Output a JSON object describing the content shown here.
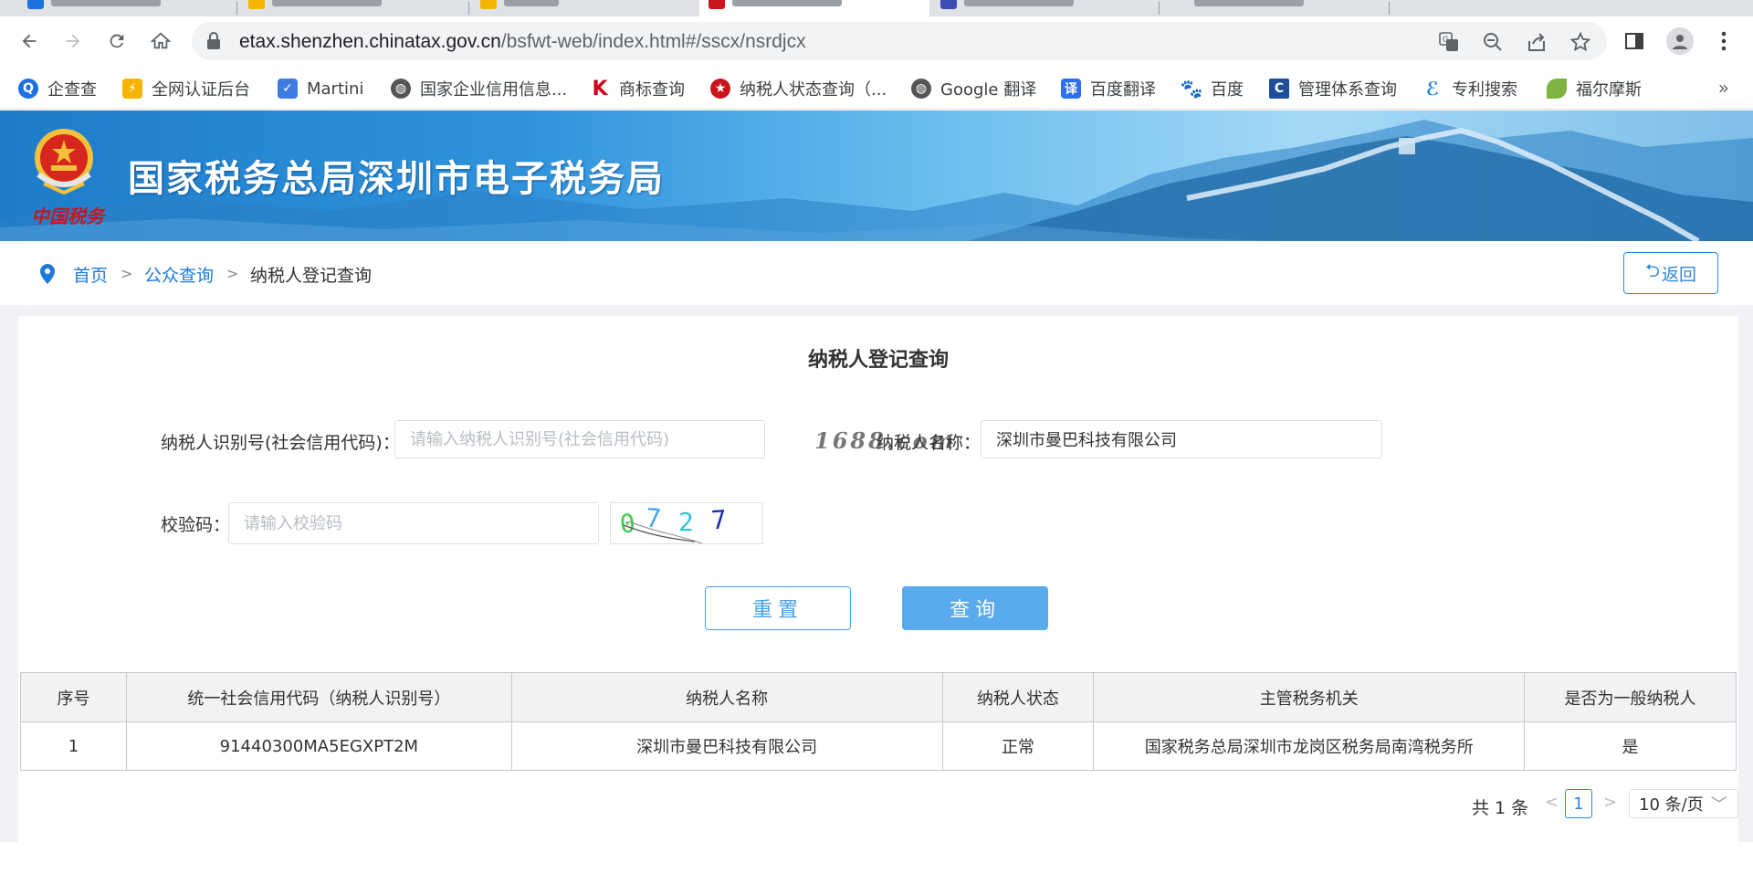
{
  "browser": {
    "url_host": "etax.shenzhen.chinatax.gov.cn",
    "url_path": "/bsfwt-web/index.html#/sscx/nsrdjcx",
    "bookmarks": [
      {
        "label": "企查查",
        "icon": "qichacha-icon",
        "color": "#1e6fe0"
      },
      {
        "label": "全网认证后台",
        "icon": "cert-backend-icon",
        "color": "#f5b400"
      },
      {
        "label": "Martini",
        "icon": "shield-icon",
        "color": "#3d7be0"
      },
      {
        "label": "国家企业信用信息...",
        "icon": "globe-icon",
        "color": "#555555"
      },
      {
        "label": "商标查询",
        "icon": "k-logo-icon",
        "color": "#d0021b"
      },
      {
        "label": "纳税人状态查询（...",
        "icon": "tax-emblem-icon",
        "color": "#c8161d"
      },
      {
        "label": "Google 翻译",
        "icon": "globe-icon",
        "color": "#555555"
      },
      {
        "label": "百度翻译",
        "icon": "baidu-translate-icon",
        "color": "#2f6fe8"
      },
      {
        "label": "百度",
        "icon": "baidu-paw-icon",
        "color": "#2932e1"
      },
      {
        "label": "管理体系查询",
        "icon": "cnas-icon",
        "color": "#1f4e9a"
      },
      {
        "label": "专利搜索",
        "icon": "patent-icon",
        "color": "#1e88e5"
      },
      {
        "label": "福尔摩斯",
        "icon": "leaf-icon",
        "color": "#7cb342"
      }
    ],
    "more": "»"
  },
  "banner": {
    "title": "国家税务总局深圳市电子税务局",
    "emblem_caption": "中国税务"
  },
  "breadcrumb": {
    "home": "首页",
    "sep1": ">",
    "public": "公众查询",
    "sep2": ">",
    "current": "纳税人登记查询",
    "back": "返回"
  },
  "form": {
    "title": "纳税人登记查询",
    "tin_label": "纳税人识别号(社会信用代码)：",
    "tin_placeholder": "请输入纳税人识别号(社会信用代码)",
    "tin_value": "",
    "name_label": "纳税人名称：",
    "name_value": "深圳市曼巴科技有限公司",
    "captcha_label": "校验码：",
    "captcha_placeholder": "请输入校验码",
    "captcha_text": "0727",
    "watermark": "1688.com",
    "reset": "重置",
    "query": "查询"
  },
  "table": {
    "headers": [
      "序号",
      "统一社会信用代码（纳税人识别号）",
      "纳税人名称",
      "纳税人状态",
      "主管税务机关",
      "是否为一般纳税人"
    ],
    "rows": [
      [
        "1",
        "91440300MA5EGXPT2M",
        "深圳市曼巴科技有限公司",
        "正常",
        "国家税务总局深圳市龙岗区税务局南湾税务所",
        "是"
      ]
    ]
  },
  "pagination": {
    "total": "共 1 条",
    "prev": "<",
    "current_page": "1",
    "next": ">",
    "page_size": "10 条/页"
  },
  "colors": {
    "brand_blue": "#2f86d6",
    "query_button": "#5aaaee",
    "banner_start": "#1e7cc9",
    "emblem_red": "#c8161d"
  }
}
